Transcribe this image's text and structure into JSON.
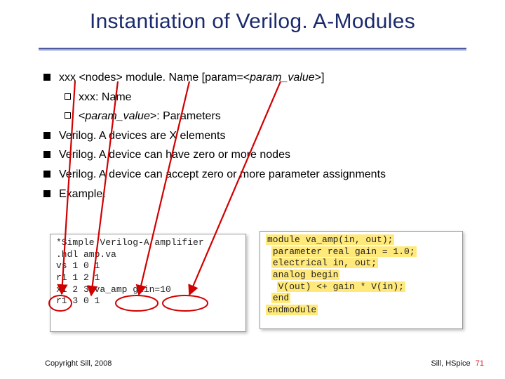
{
  "title": "Instantiation of Verilog. A-Modules",
  "bullets": {
    "b1_html": " xxx &lt;nodes&gt; module. Name [param=&lt;<i>param_value</i>&gt;]",
    "b1a_html": "xxx: Name",
    "b1b_html": "&lt;<i>param_value</i>&gt;: Parameters",
    "b2": "Verilog. A devices are X elements",
    "b3": "Verilog. A device can have zero or more nodes",
    "b4": "Verilog. A device can accept zero or more parameter assignments",
    "b5": "Example:"
  },
  "code": {
    "netlist": "*Simple Verilog-A amplifier\n.hdl amp.va\nvs 1 0 1\nr1 1 2 1\nx1 2 3 va_amp gain=10\nr1 3 0 1",
    "module_html": "<span class=\"hl\">module va_amp(in, out);</span>\n <span class=\"hl\">parameter real gain = 1.0;</span>\n <span class=\"hl\">electrical in, out;</span>\n <span class=\"hl\">analog begin</span>\n  <span class=\"hl\">V(out) &lt;+ gain * V(in);</span>\n <span class=\"hl\">end</span>\n<span class=\"hl\">endmodule</span>"
  },
  "copyright": "Copyright Sill, 2008",
  "footer": {
    "label": "Sill, HSpice",
    "page": "71"
  }
}
